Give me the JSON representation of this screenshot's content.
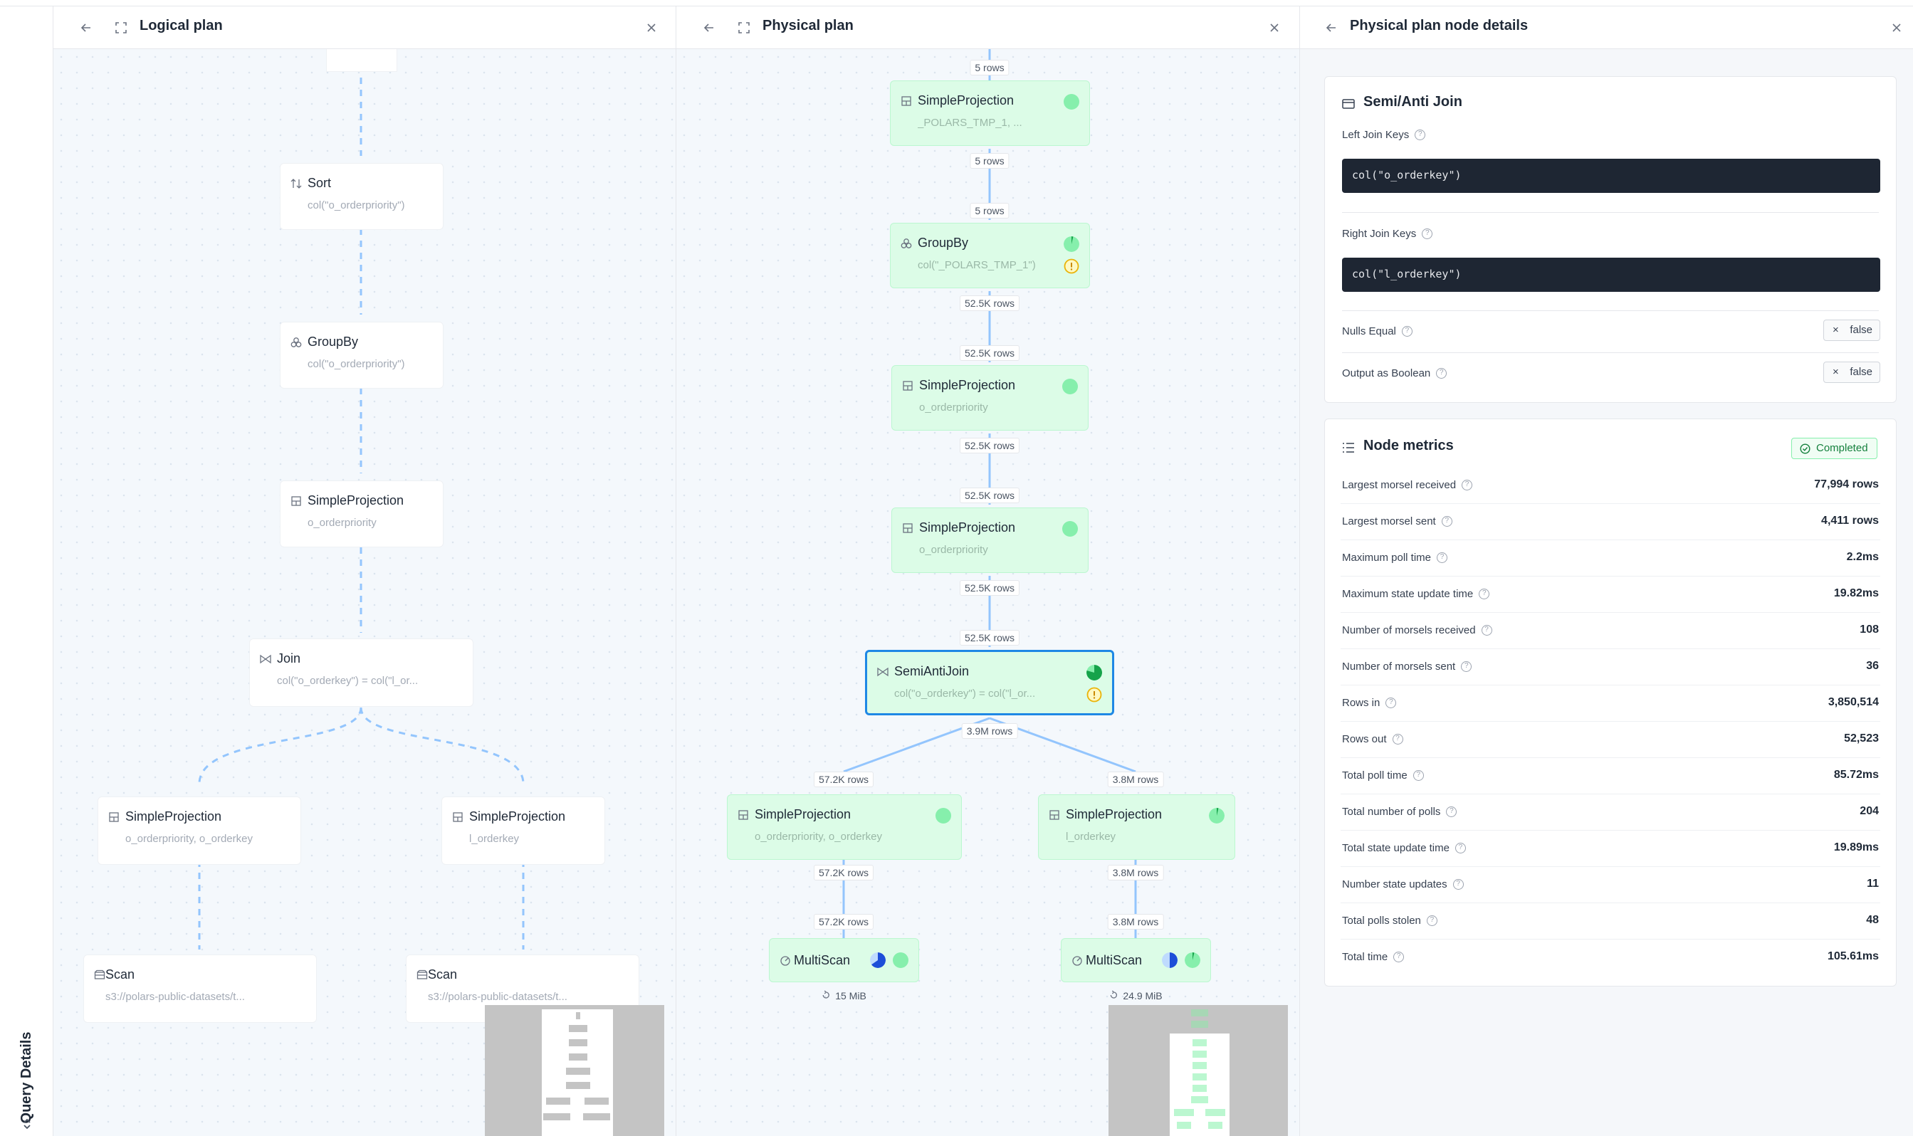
{
  "sidebar": {
    "label": "Query Details"
  },
  "logical_panel": {
    "title": "Logical plan",
    "nodes": [
      {
        "name": "Sort",
        "sub": "col(\"o_orderpriority\")"
      },
      {
        "name": "GroupBy",
        "sub": "col(\"o_orderpriority\")"
      },
      {
        "name": "SimpleProjection",
        "sub": "o_orderpriority"
      },
      {
        "name": "Join",
        "sub": "col(\"o_orderkey\") = col(\"l_or..."
      },
      {
        "name": "SimpleProjection",
        "sub": "o_orderpriority, o_orderkey"
      },
      {
        "name": "SimpleProjection",
        "sub": "l_orderkey"
      },
      {
        "name": "Scan",
        "sub": "s3://polars-public-datasets/t..."
      },
      {
        "name": "Scan",
        "sub": "s3://polars-public-datasets/t..."
      }
    ]
  },
  "physical_panel": {
    "title": "Physical plan",
    "nodes": [
      {
        "name": "SimpleProjection",
        "sub": "_POLARS_TMP_1, ..."
      },
      {
        "name": "GroupBy",
        "sub": "col(\"_POLARS_TMP_1\")"
      },
      {
        "name": "SimpleProjection",
        "sub": "o_orderpriority"
      },
      {
        "name": "SimpleProjection",
        "sub": "o_orderpriority"
      },
      {
        "name": "SemiAntiJoin",
        "sub": "col(\"o_orderkey\") = col(\"l_or..."
      },
      {
        "name": "SimpleProjection",
        "sub": "o_orderpriority, o_orderkey"
      },
      {
        "name": "SimpleProjection",
        "sub": "l_orderkey"
      },
      {
        "name": "MultiScan",
        "sub": ""
      },
      {
        "name": "MultiScan",
        "sub": ""
      }
    ],
    "edge_labels": [
      "5 rows",
      "5 rows",
      "5 rows",
      "52.5K rows",
      "52.5K rows",
      "52.5K rows",
      "52.5K rows",
      "52.5K rows",
      "52.5K rows",
      "3.9M rows",
      "57.2K rows",
      "3.8M rows",
      "57.2K rows",
      "57.2K rows",
      "3.8M rows",
      "3.8M rows"
    ],
    "scan_sizes": [
      "15 MiB",
      "24.9 MiB"
    ]
  },
  "details_panel": {
    "title": "Physical plan node details",
    "join_card": {
      "title": "Semi/Anti Join",
      "left_keys_label": "Left Join Keys",
      "left_keys_value": "col(\"o_orderkey\")",
      "right_keys_label": "Right Join Keys",
      "right_keys_value": "col(\"l_orderkey\")",
      "nulls_equal_label": "Nulls Equal",
      "nulls_equal_value": "false",
      "output_bool_label": "Output as Boolean",
      "output_bool_value": "false"
    },
    "metrics_card": {
      "title": "Node metrics",
      "status": "Completed",
      "rows": [
        {
          "label": "Largest morsel received",
          "value": "77,994 rows"
        },
        {
          "label": "Largest morsel sent",
          "value": "4,411 rows"
        },
        {
          "label": "Maximum poll time",
          "value": "2.2ms"
        },
        {
          "label": "Maximum state update time",
          "value": "19.82ms"
        },
        {
          "label": "Number of morsels received",
          "value": "108"
        },
        {
          "label": "Number of morsels sent",
          "value": "36"
        },
        {
          "label": "Rows in",
          "value": "3,850,514"
        },
        {
          "label": "Rows out",
          "value": "52,523"
        },
        {
          "label": "Total poll time",
          "value": "85.72ms"
        },
        {
          "label": "Total number of polls",
          "value": "204"
        },
        {
          "label": "Total state update time",
          "value": "19.89ms"
        },
        {
          "label": "Number state updates",
          "value": "11"
        },
        {
          "label": "Total polls stolen",
          "value": "48"
        },
        {
          "label": "Total time",
          "value": "105.61ms"
        }
      ]
    }
  },
  "colors": {
    "accent": "#1e88e5",
    "node_green": "#dcfce7",
    "status_green": "#15803d",
    "code_bg": "#1e2633"
  }
}
